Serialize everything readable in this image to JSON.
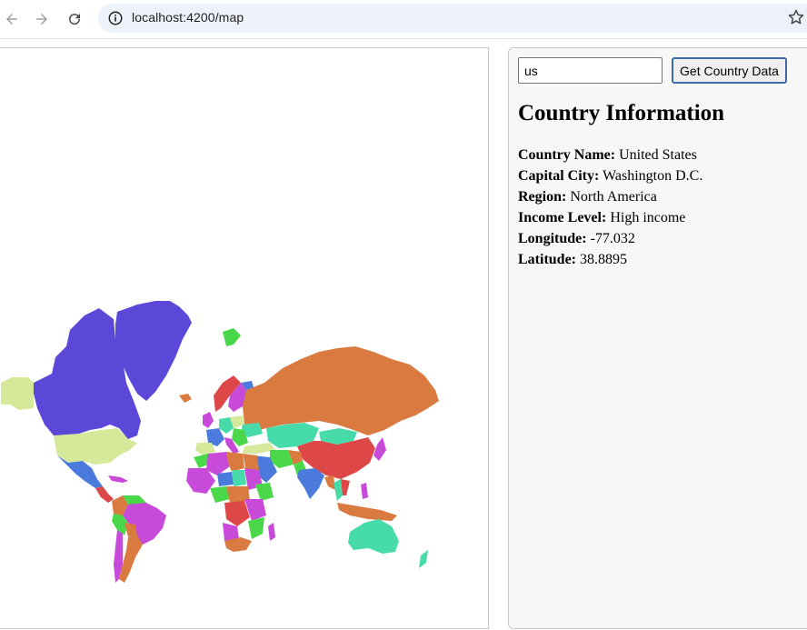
{
  "browser": {
    "url": "localhost:4200/map",
    "back_icon": "back-arrow-icon",
    "forward_icon": "forward-arrow-icon",
    "reload_icon": "reload-icon",
    "info_icon": "site-info-icon",
    "bookmark_icon": "star-icon"
  },
  "search": {
    "value": "us",
    "button_label": "Get Country Data"
  },
  "info": {
    "title": "Country Information",
    "fields": [
      {
        "label": "Country Name:",
        "value": "United States"
      },
      {
        "label": "Capital City:",
        "value": "Washington D.C."
      },
      {
        "label": "Region:",
        "value": "North America"
      },
      {
        "label": "Income Level:",
        "value": "High income"
      },
      {
        "label": "Longitude:",
        "value": "-77.032"
      },
      {
        "label": "Latitude:",
        "value": "38.8895"
      }
    ]
  },
  "colors": {
    "purple": "#5c48d8",
    "yellow_green": "#d6e89a",
    "orange": "#d97b40",
    "red": "#de4747",
    "teal": "#47dbaa",
    "blue": "#4a7bdc",
    "magenta": "#c84ad8",
    "green": "#4ad84a",
    "accent_button": "#3e6aa6"
  }
}
